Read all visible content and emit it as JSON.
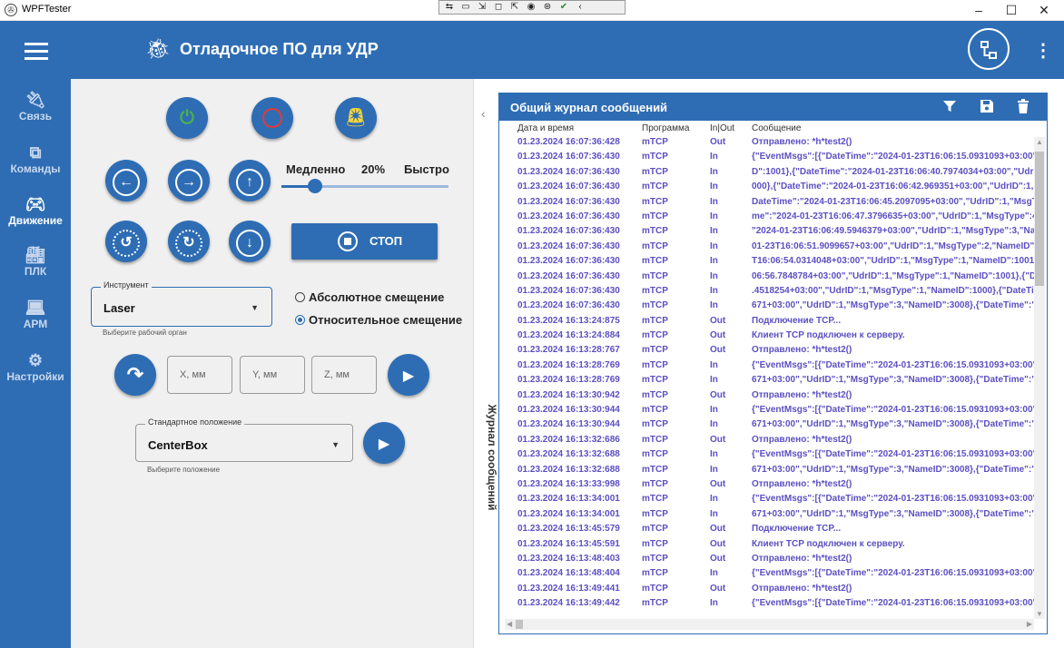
{
  "window": {
    "title": "WPFTester",
    "minimize": "–",
    "maximize": "☐",
    "close": "✕"
  },
  "debug_toolbar": {
    "icons": [
      "⇆",
      "▭",
      "⇲",
      "◻",
      "⇱",
      "◉",
      "⊛",
      "✔",
      "‹"
    ]
  },
  "appbar": {
    "title": "Отладочное ПО для УДР"
  },
  "sidenav": {
    "items": [
      {
        "label": "Связь",
        "icon": "plug-icon"
      },
      {
        "label": "Команды",
        "icon": "code-icon"
      },
      {
        "label": "Движение",
        "icon": "gamepad-icon",
        "active": true
      },
      {
        "label": "ПЛК",
        "icon": "factory-icon"
      },
      {
        "label": "АРМ",
        "icon": "computer-icon"
      },
      {
        "label": "Настройки",
        "icon": "gear-icon"
      }
    ]
  },
  "motion": {
    "speed": {
      "slow_label": "Медленно",
      "value_label": "20%",
      "fast_label": "Быстро",
      "value": 0.2
    },
    "stop_label": "СТОП",
    "instrument": {
      "legend": "Инструмент",
      "value": "Laser",
      "helper": "Выберите рабочий орган"
    },
    "offset_modes": [
      {
        "label": "Абсолютное смещение",
        "selected": false
      },
      {
        "label": "Относительное смещение",
        "selected": true
      }
    ],
    "coords": {
      "x_placeholder": "X, мм",
      "y_placeholder": "Y, мм",
      "z_placeholder": "Z, мм"
    },
    "standard_position": {
      "legend": "Стандартное положение",
      "value": "CenterBox",
      "helper": "Выберите положение"
    }
  },
  "log_collapse": {
    "label": "Журнал сообщений"
  },
  "log": {
    "title": "Общий журнал сообщений",
    "columns": [
      "Дата и время",
      "Программа",
      "In|Out",
      "Сообщение"
    ],
    "rows": [
      [
        "01.23.2024 16:07:36:428",
        "mTCP",
        "Out",
        "Отправлено: *h*test2()"
      ],
      [
        "01.23.2024 16:07:36:430",
        "mTCP",
        "In",
        "{\"EventMsgs\":[{\"DateTime\":\"2024-01-23T16:06:15.0931093+03:00\","
      ],
      [
        "01.23.2024 16:07:36:430",
        "mTCP",
        "In",
        "D\":1001},{\"DateTime\":\"2024-01-23T16:06:40.7974034+03:00\",\"UdrID"
      ],
      [
        "01.23.2024 16:07:36:430",
        "mTCP",
        "In",
        "000},{\"DateTime\":\"2024-01-23T16:06:42.969351+03:00\",\"UdrID\":1,\"M"
      ],
      [
        "01.23.2024 16:07:36:430",
        "mTCP",
        "In",
        "DateTime\":\"2024-01-23T16:06:45.2097095+03:00\",\"UdrID\":1,\"MsgTy"
      ],
      [
        "01.23.2024 16:07:36:430",
        "mTCP",
        "In",
        "me\":\"2024-01-23T16:06:47.3796635+03:00\",\"UdrID\":1,\"MsgType\":4,\""
      ],
      [
        "01.23.2024 16:07:36:430",
        "mTCP",
        "In",
        "\"2024-01-23T16:06:49.5946379+03:00\",\"UdrID\":1,\"MsgType\":3,\"Nam"
      ],
      [
        "01.23.2024 16:07:36:430",
        "mTCP",
        "In",
        "01-23T16:06:51.9099657+03:00\",\"UdrID\":1,\"MsgType\":2,\"NameID\":20"
      ],
      [
        "01.23.2024 16:07:36:430",
        "mTCP",
        "In",
        "T16:06:54.0314048+03:00\",\"UdrID\":1,\"MsgType\":1,\"NameID\":1001},{\""
      ],
      [
        "01.23.2024 16:07:36:430",
        "mTCP",
        "In",
        "06:56.7848784+03:00\",\"UdrID\":1,\"MsgType\":1,\"NameID\":1001},{\"Date"
      ],
      [
        "01.23.2024 16:07:36:430",
        "mTCP",
        "In",
        ".4518254+03:00\",\"UdrID\":1,\"MsgType\":1,\"NameID\":1000},{\"DateTime\""
      ],
      [
        "01.23.2024 16:07:36:430",
        "mTCP",
        "In",
        "671+03:00\",\"UdrID\":1,\"MsgType\":3,\"NameID\":3008},{\"DateTime\":\"2024"
      ],
      [
        "01.23.2024 16:13:24:875",
        "mTCP",
        "Out",
        "Подключение TCP..."
      ],
      [
        "01.23.2024 16:13:24:884",
        "mTCP",
        "Out",
        "Клиент TCP подключен к серверу."
      ],
      [
        "01.23.2024 16:13:28:767",
        "mTCP",
        "Out",
        "Отправлено: *h*test2()"
      ],
      [
        "01.23.2024 16:13:28:769",
        "mTCP",
        "In",
        "{\"EventMsgs\":[{\"DateTime\":\"2024-01-23T16:06:15.0931093+03:00\","
      ],
      [
        "01.23.2024 16:13:28:769",
        "mTCP",
        "In",
        "671+03:00\",\"UdrID\":1,\"MsgType\":3,\"NameID\":3008},{\"DateTime\":\"2024"
      ],
      [
        "01.23.2024 16:13:30:942",
        "mTCP",
        "Out",
        "Отправлено: *h*test2()"
      ],
      [
        "01.23.2024 16:13:30:944",
        "mTCP",
        "In",
        "{\"EventMsgs\":[{\"DateTime\":\"2024-01-23T16:06:15.0931093+03:00\","
      ],
      [
        "01.23.2024 16:13:30:944",
        "mTCP",
        "In",
        "671+03:00\",\"UdrID\":1,\"MsgType\":3,\"NameID\":3008},{\"DateTime\":\"2024"
      ],
      [
        "01.23.2024 16:13:32:686",
        "mTCP",
        "Out",
        "Отправлено: *h*test2()"
      ],
      [
        "01.23.2024 16:13:32:688",
        "mTCP",
        "In",
        "{\"EventMsgs\":[{\"DateTime\":\"2024-01-23T16:06:15.0931093+03:00\","
      ],
      [
        "01.23.2024 16:13:32:688",
        "mTCP",
        "In",
        "671+03:00\",\"UdrID\":1,\"MsgType\":3,\"NameID\":3008},{\"DateTime\":\"2024"
      ],
      [
        "01.23.2024 16:13:33:998",
        "mTCP",
        "Out",
        "Отправлено: *h*test2()"
      ],
      [
        "01.23.2024 16:13:34:001",
        "mTCP",
        "In",
        "{\"EventMsgs\":[{\"DateTime\":\"2024-01-23T16:06:15.0931093+03:00\","
      ],
      [
        "01.23.2024 16:13:34:001",
        "mTCP",
        "In",
        "671+03:00\",\"UdrID\":1,\"MsgType\":3,\"NameID\":3008},{\"DateTime\":\"2024"
      ],
      [
        "01.23.2024 16:13:45:579",
        "mTCP",
        "Out",
        "Подключение TCP..."
      ],
      [
        "01.23.2024 16:13:45:591",
        "mTCP",
        "Out",
        "Клиент TCP подключен к серверу."
      ],
      [
        "01.23.2024 16:13:48:403",
        "mTCP",
        "Out",
        "Отправлено: *h*test2()"
      ],
      [
        "01.23.2024 16:13:48:404",
        "mTCP",
        "In",
        "{\"EventMsgs\":[{\"DateTime\":\"2024-01-23T16:06:15.0931093+03:00\","
      ],
      [
        "01.23.2024 16:13:49:441",
        "mTCP",
        "Out",
        "Отправлено: *h*test2()"
      ],
      [
        "01.23.2024 16:13:49:442",
        "mTCP",
        "In",
        "{\"EventMsgs\":[{\"DateTime\":\"2024-01-23T16:06:15.0931093+03:00\","
      ]
    ]
  },
  "colors": {
    "primary": "#2e6db4",
    "log_text": "#5b4fc2",
    "power_green": "#4caf50",
    "record_red": "#e53935",
    "alarm_yellow": "#f5d33a"
  }
}
